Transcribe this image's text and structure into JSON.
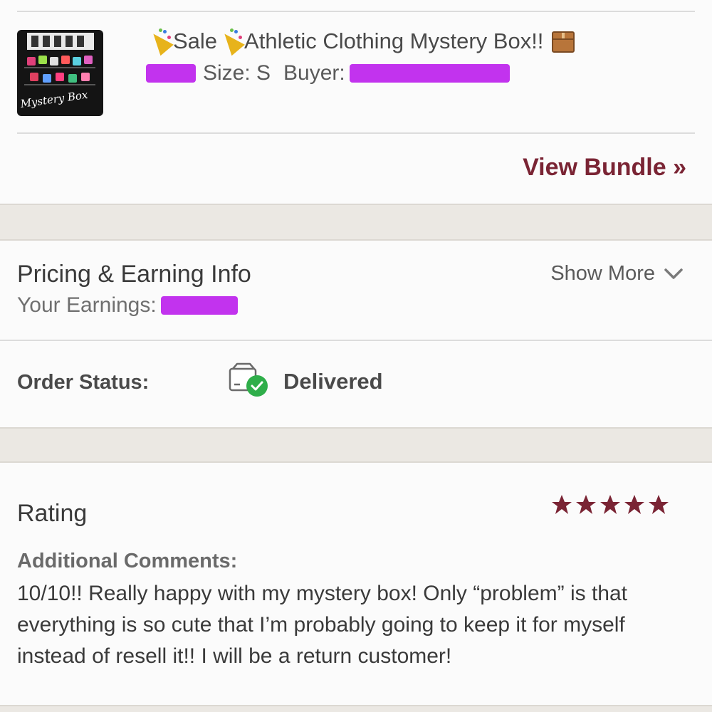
{
  "listing": {
    "thumbnail_caption": "Mystery Box",
    "title_part1": "Sale",
    "title_part2": "Athletic Clothing Mystery Box!!",
    "size_text": "Size: S",
    "buyer_label": "Buyer:",
    "title_icons": [
      "party-popper-icon",
      "party-popper-icon",
      "package-icon"
    ]
  },
  "bundle": {
    "view_label": "View Bundle »"
  },
  "pricing": {
    "title": "Pricing & Earning Info",
    "earnings_label": "Your Earnings:",
    "show_more_label": "Show More"
  },
  "order": {
    "status_label": "Order Status:",
    "status_value": "Delivered",
    "status_icon": "delivered-box-check-icon"
  },
  "rating": {
    "title": "Rating",
    "stars": 5,
    "max_stars": 5,
    "comments_label": "Additional Comments:",
    "comment_text": "10/10!! Really happy with my mystery box! Only “problem” is that everything is so cute that I’m probably going to keep it for myself instead of resell it!! I will be a return customer!"
  },
  "colors": {
    "accent": "#7a2434",
    "redaction": "#c233ee",
    "success": "#2fae4a",
    "section_gap": "#ebe8e3"
  }
}
